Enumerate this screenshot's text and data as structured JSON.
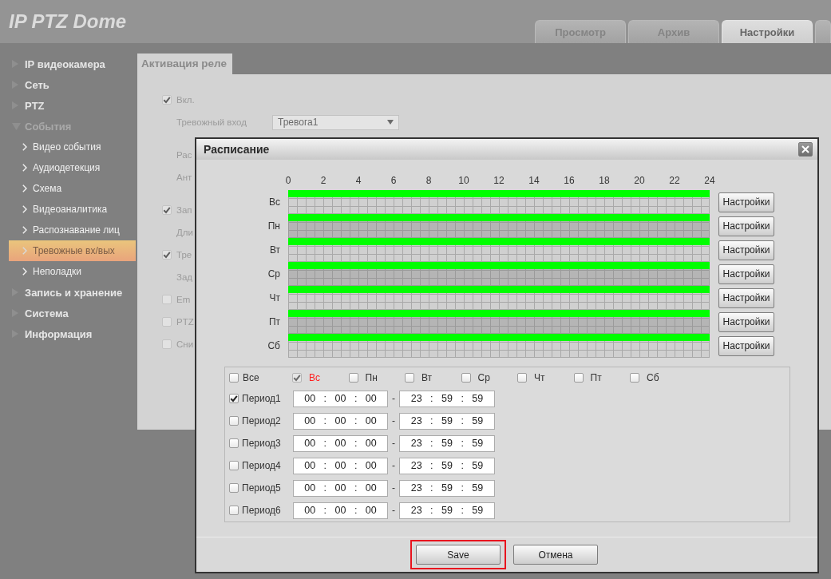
{
  "header": {
    "title": "IP PTZ Dome"
  },
  "top_tabs": [
    {
      "label": "Просмотр",
      "selected": false
    },
    {
      "label": "Архив",
      "selected": false
    },
    {
      "label": "Настройки",
      "selected": true
    },
    {
      "selected": false
    }
  ],
  "sidebar": {
    "items": [
      {
        "label": "IP видеокамера",
        "expanded": false
      },
      {
        "label": "Сеть",
        "expanded": false
      },
      {
        "label": "PTZ",
        "expanded": false
      },
      {
        "label": "События",
        "expanded": true,
        "children": [
          {
            "label": "Видео события",
            "selected": false
          },
          {
            "label": "Аудиодетекция",
            "selected": false
          },
          {
            "label": "Схема",
            "selected": false
          },
          {
            "label": "Видеоаналитика",
            "selected": false
          },
          {
            "label": "Распознавание лиц",
            "selected": false
          },
          {
            "label": "Тревожные вх/вых",
            "selected": true
          },
          {
            "label": "Неполадки",
            "selected": false
          }
        ]
      },
      {
        "label": "Запись и хранение",
        "expanded": false
      },
      {
        "label": "Система",
        "expanded": false
      },
      {
        "label": "Информация",
        "expanded": false
      }
    ]
  },
  "settings_page": {
    "tab": "Активация реле",
    "rows": [
      {
        "kind": "checkbox",
        "label": "Вкл.",
        "checked": true
      },
      {
        "kind": "select",
        "label": "Тревожный вход",
        "value": "Тревога1"
      },
      {
        "kind": "label",
        "label": "Рас"
      },
      {
        "kind": "label",
        "label": "Ант"
      },
      {
        "kind": "checkbox",
        "label": "Зап",
        "checked": true
      },
      {
        "kind": "label",
        "label": "Дли"
      },
      {
        "kind": "checkbox",
        "label": "Тре",
        "checked": true
      },
      {
        "kind": "label",
        "label": "Зад"
      },
      {
        "kind": "checkbox",
        "label": "Em",
        "checked": false
      },
      {
        "kind": "checkbox",
        "label": "PTZ",
        "checked": false
      },
      {
        "kind": "checkbox",
        "label": "Сни",
        "checked": false
      }
    ]
  },
  "schedule_dialog": {
    "title": "Расписание",
    "hours": [
      "0",
      "2",
      "4",
      "6",
      "8",
      "10",
      "12",
      "14",
      "16",
      "18",
      "20",
      "22",
      "24"
    ],
    "days": [
      {
        "label": "Вс",
        "level": 1,
        "button": "Настройки"
      },
      {
        "label": "Пн",
        "level": 1,
        "button": "Настройки"
      },
      {
        "label": "Вт",
        "level": 1,
        "button": "Настройки"
      },
      {
        "label": "Ср",
        "level": 1,
        "button": "Настройки"
      },
      {
        "label": "Чт",
        "level": 1,
        "button": "Настройки"
      },
      {
        "label": "Пт",
        "level": 1,
        "button": "Настройки"
      },
      {
        "label": "Сб",
        "level": 1,
        "button": "Настройки"
      }
    ],
    "day_select": [
      {
        "label": "Все",
        "checked": false,
        "disabled": false,
        "current": false
      },
      {
        "label": "Вс",
        "checked": true,
        "disabled": true,
        "current": true
      },
      {
        "label": "Пн",
        "checked": false,
        "disabled": false,
        "current": false
      },
      {
        "label": "Вт",
        "checked": false,
        "disabled": false,
        "current": false
      },
      {
        "label": "Ср",
        "checked": false,
        "disabled": false,
        "current": false
      },
      {
        "label": "Чт",
        "checked": false,
        "disabled": false,
        "current": false
      },
      {
        "label": "Пт",
        "checked": false,
        "disabled": false,
        "current": false
      },
      {
        "label": "Сб",
        "checked": false,
        "disabled": false,
        "current": false
      }
    ],
    "periods": [
      {
        "label": "Период1",
        "checked": true,
        "start": "00 : 00 : 00",
        "separator": "-",
        "end": "23 : 59 : 59"
      },
      {
        "label": "Период2",
        "checked": false,
        "start": "00 : 00 : 00",
        "separator": "-",
        "end": "23 : 59 : 59"
      },
      {
        "label": "Период3",
        "checked": false,
        "start": "00 : 00 : 00",
        "separator": "-",
        "end": "23 : 59 : 59"
      },
      {
        "label": "Период4",
        "checked": false,
        "start": "00 : 00 : 00",
        "separator": "-",
        "end": "23 : 59 : 59"
      },
      {
        "label": "Период5",
        "checked": false,
        "start": "00 : 00 : 00",
        "separator": "-",
        "end": "23 : 59 : 59"
      },
      {
        "label": "Период6",
        "checked": false,
        "start": "00 : 00 : 00",
        "separator": "-",
        "end": "23 : 59 : 59"
      }
    ],
    "buttons": [
      {
        "label": "Save",
        "highlighted": true
      },
      {
        "label": "Отмена",
        "highlighted": false
      }
    ]
  }
}
